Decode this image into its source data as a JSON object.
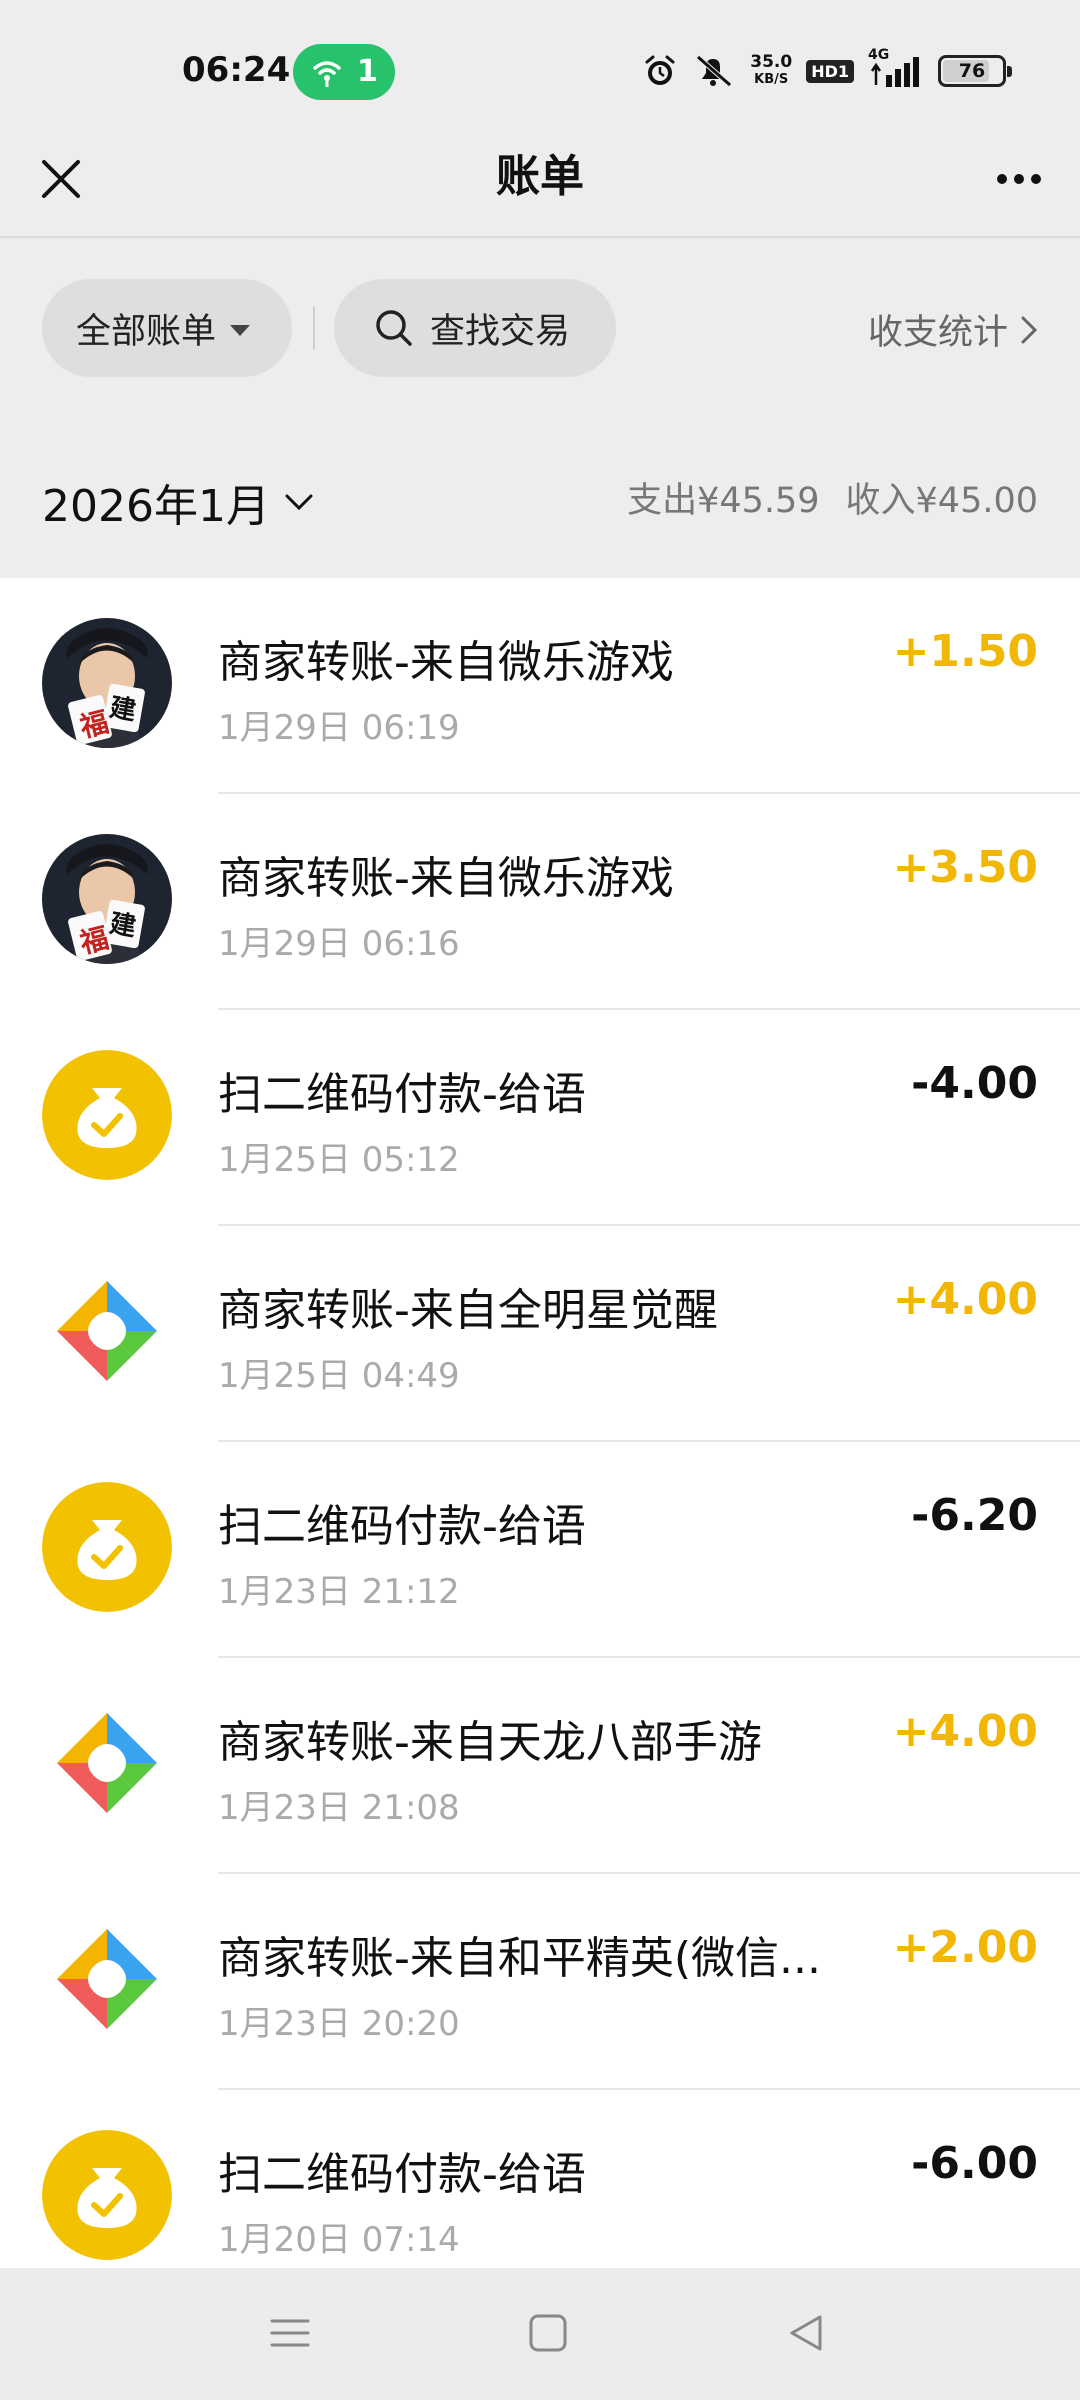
{
  "status_bar": {
    "time": "06:24",
    "hotspot_count": "1",
    "net_speed_value": "35.0",
    "net_speed_unit": "KB/S",
    "hd_label": "HD1",
    "network": "4G",
    "battery": "76",
    "battery_level": 0.76
  },
  "nav": {
    "title": "账单",
    "close_icon": "close-icon",
    "more_icon": "more-icon"
  },
  "filter": {
    "all_bills": "全部账单",
    "search": "查找交易",
    "stats": "收支统计"
  },
  "month_header": {
    "month": "2026年1月",
    "expense": "支出¥45.59",
    "income": "收入¥45.00"
  },
  "transactions": [
    {
      "title": "商家转账-来自微乐游戏",
      "time": "1月29日 06:19",
      "amount": "+1.50",
      "kind": "income",
      "icon": "game-avatar"
    },
    {
      "title": "商家转账-来自微乐游戏",
      "time": "1月29日 06:16",
      "amount": "+3.50",
      "kind": "income",
      "icon": "game-avatar"
    },
    {
      "title": "扫二维码付款-给语",
      "time": "1月25日 05:12",
      "amount": "-4.00",
      "kind": "expense",
      "icon": "money-bag-icon"
    },
    {
      "title": "商家转账-来自全明星觉醒",
      "time": "1月25日 04:49",
      "amount": "+4.00",
      "kind": "income",
      "icon": "tencent-games-icon"
    },
    {
      "title": "扫二维码付款-给语",
      "time": "1月23日 21:12",
      "amount": "-6.20",
      "kind": "expense",
      "icon": "money-bag-icon"
    },
    {
      "title": "商家转账-来自天龙八部手游",
      "time": "1月23日 21:08",
      "amount": "+4.00",
      "kind": "income",
      "icon": "tencent-games-icon"
    },
    {
      "title": "商家转账-来自和平精英(微信...",
      "time": "1月23日 20:20",
      "amount": "+2.00",
      "kind": "income",
      "icon": "tencent-games-icon"
    },
    {
      "title": "扫二维码付款-给语",
      "time": "1月20日 07:14",
      "amount": "-6.00",
      "kind": "expense",
      "icon": "money-bag-icon"
    }
  ],
  "avatar_text": {
    "char1": "福",
    "char2": "建"
  },
  "colors": {
    "income": "#f2b705",
    "expense": "#111111",
    "money_bag": "#f2c200",
    "hotspot": "#27c26b"
  },
  "bottom_nav": [
    "menu-icon",
    "home-icon",
    "back-icon"
  ]
}
